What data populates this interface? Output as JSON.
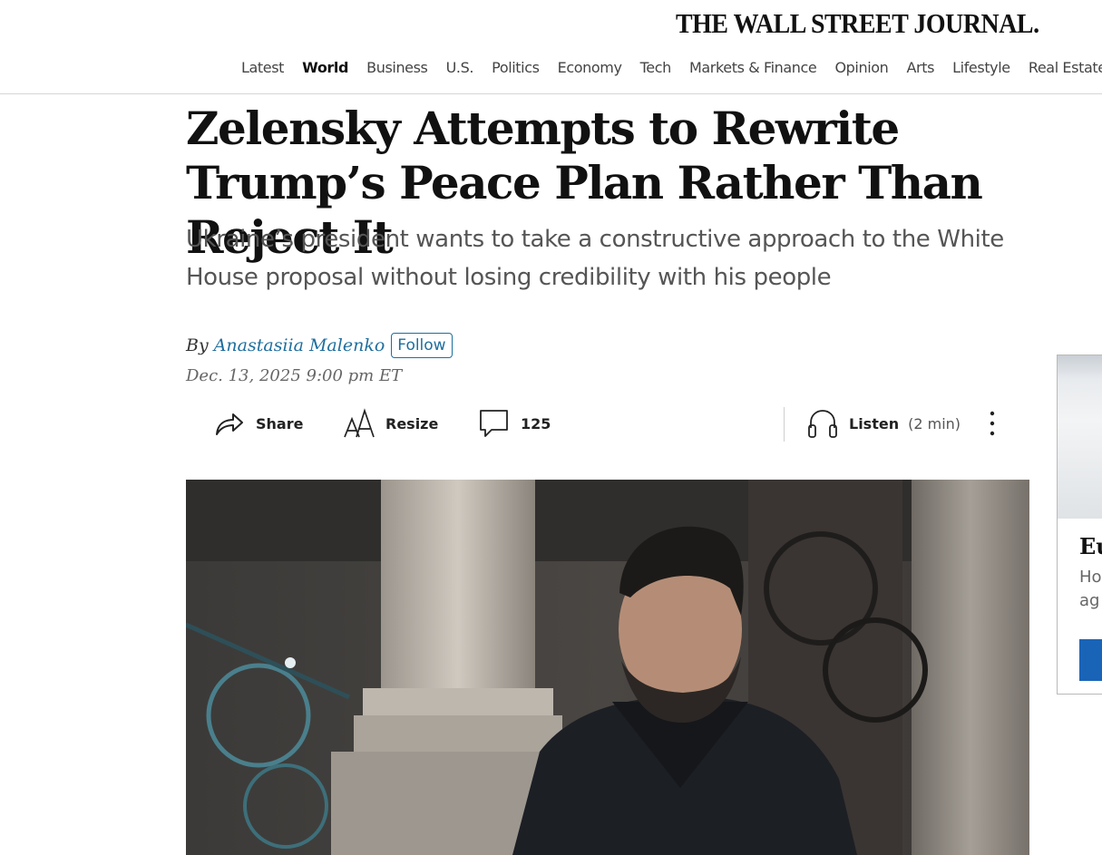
{
  "header": {
    "masthead": "THE WALL STREET JOURNAL.",
    "nav": [
      "Latest",
      "World",
      "Business",
      "U.S.",
      "Politics",
      "Economy",
      "Tech",
      "Markets & Finance",
      "Opinion",
      "Arts",
      "Lifestyle",
      "Real Estate"
    ],
    "active_nav": "World"
  },
  "article": {
    "headline": "Zelensky Attempts to Rewrite Trump’s Peace Plan Rather Than Reject It",
    "dek": "Ukraine’s president wants to take a constructive approach to the White House proposal without losing credibility with his people",
    "byline_prefix": "By",
    "author": "Anastasiia Malenko",
    "follow_label": "Follow",
    "timestamp": "Dec. 13, 2025 9:00 pm ET"
  },
  "toolbar": {
    "share_label": "Share",
    "resize_label": "Resize",
    "comments_count": "125",
    "listen_label": "Listen",
    "listen_duration": "(2 min)"
  },
  "ad": {
    "title_fragment": "Eu",
    "text_fragment_1": "Ho",
    "text_fragment_2": "ag"
  },
  "colors": {
    "link": "#1f6e9e",
    "ad_button": "#1a64b8",
    "divider": "#d6d6d6"
  },
  "icons": [
    "share-icon",
    "resize-icon",
    "comment-icon",
    "headphones-icon",
    "more-options-icon"
  ]
}
